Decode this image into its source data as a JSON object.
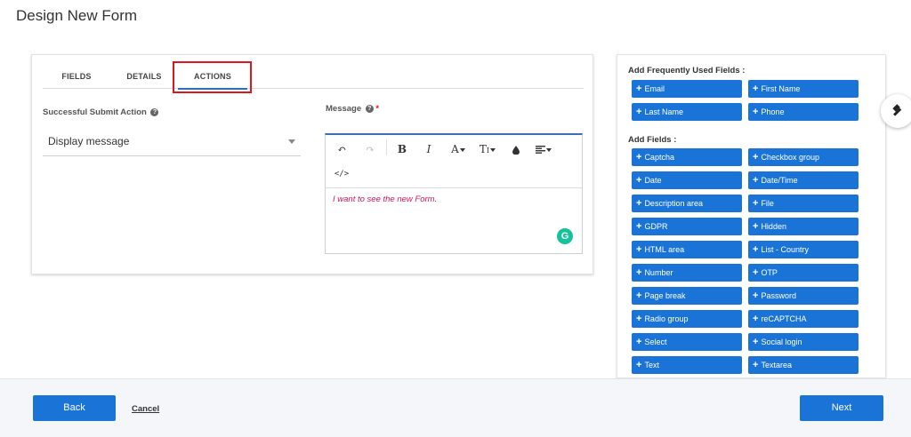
{
  "page": {
    "title": "Design New Form"
  },
  "tabs": [
    {
      "label": "FIELDS"
    },
    {
      "label": "DETAILS"
    },
    {
      "label": "ACTIONS"
    }
  ],
  "submit_action": {
    "label": "Successful Submit Action",
    "selected": "Display message"
  },
  "message": {
    "label": "Message",
    "required_mark": "*",
    "content": "I want to see the new Form."
  },
  "editor_toolbar": {
    "undo": "↶",
    "redo": "↷",
    "bold": "B",
    "italic": "I",
    "font_color": "A",
    "text_size": "T",
    "source": "</>"
  },
  "fields_panel": {
    "frequent_heading": "Add Frequently Used Fields :",
    "frequent": [
      "Email",
      "First Name",
      "Last Name",
      "Phone"
    ],
    "all_heading": "Add Fields :",
    "all": [
      "Captcha",
      "Checkbox group",
      "Date",
      "Date/Time",
      "Description area",
      "File",
      "GDPR",
      "Hidden",
      "HTML area",
      "List - Country",
      "Number",
      "OTP",
      "Page break",
      "Password",
      "Radio group",
      "reCAPTCHA",
      "Select",
      "Social login",
      "Text",
      "Textarea"
    ]
  },
  "footer": {
    "back_label": "Back",
    "cancel_label": "Cancel",
    "next_label": "Next"
  },
  "colors": {
    "primary": "#1a74d8",
    "highlight": "#e0151d",
    "message_text": "#d2155a",
    "grammarly": "#15c39a"
  }
}
